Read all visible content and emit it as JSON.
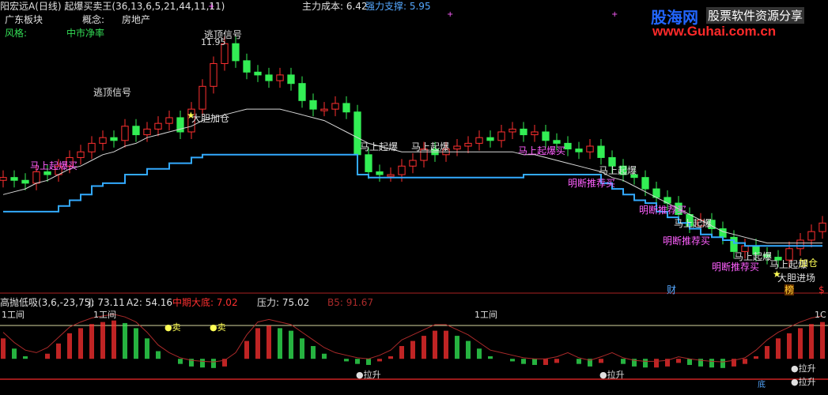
{
  "header": {
    "title": "阳宏远A(日线) 起爆买卖王(36,13,6,5,21,44,11,11)",
    "main_cost_label": "主力成本: 6.42",
    "support_label": "强力支撑: 5.95",
    "sector_label": "广东板块",
    "concept_label": "概念:",
    "concept_value": "房地产",
    "style_label": "风格:",
    "style_value": "中市净率"
  },
  "logo": {
    "brand": "股海网",
    "slogan": "股票软件资源分享",
    "url": "www.Guhai.com.cn"
  },
  "upper_annotations": {
    "top_price": "11.95",
    "escape_signal_1": "逃顶信号",
    "escape_signal_2": "逃顶信号",
    "add_position": "大胆加仓",
    "surge_buy": "马上起爆买",
    "surge_1": "马上起爆",
    "surge_2": "马上起爆",
    "surge_buy_2": "马上起爆买",
    "surge_3": "马上起爆",
    "surge_4": "马上起爆",
    "surge_5": "马上起爆",
    "surge_6": "马上起爆",
    "recommend_buy_1": "明断推荐买",
    "recommend_buy_2": "明断推荐买",
    "recommend_buy_3": "明断推荐买",
    "recommend_buy_4": "明断推荐买",
    "add_position_2": "加仓",
    "brave_entry": "大胆进场",
    "cai_mark": "财",
    "bang_mark": "榜",
    "dollar_mark": "$"
  },
  "lower_header": {
    "indicator_name": "高抛低吸(3,6,-23,75)",
    "j_value": "J: 73.11",
    "a2_value": "A2: 54.16",
    "mid_bottom": "中期大底: 7.02",
    "pressure": "压力: 75.02",
    "b5": "B5: 91.67"
  },
  "lower_annotations": {
    "peak_1": "1工间",
    "peak_2": "1工间",
    "peak_3": "1工间",
    "sell_1": "●卖",
    "sell_2": "●卖",
    "pull_1": "●拉升",
    "pull_2": "●拉升",
    "pull_3": "●拉升",
    "pull_4": "●拉升",
    "low_mark": "底",
    "right_mark": "1C"
  },
  "colors": {
    "up": "#ff3030",
    "down": "#33ee55",
    "support_line": "#33aaff",
    "ma_line": "#d8d8d8",
    "magenta": "#ff55ff",
    "yellow": "#ffff55"
  },
  "chart_data": [
    {
      "type": "line",
      "title": "阳宏远A(日线) 起爆买卖王(36,13,6,5,21,44,11,11)",
      "series": [
        {
          "name": "close",
          "values": [
            7.2,
            7.1,
            7.0,
            7.4,
            7.3,
            7.6,
            7.9,
            8.1,
            8.4,
            8.6,
            8.5,
            9.0,
            8.7,
            8.9,
            9.1,
            9.3,
            8.8,
            9.6,
            10.4,
            11.2,
            11.9,
            11.3,
            10.9,
            10.8,
            10.6,
            10.8,
            10.5,
            9.9,
            9.6,
            9.6,
            9.8,
            9.5,
            8.0,
            7.4,
            7.3,
            7.3,
            7.6,
            7.8,
            8.2,
            8.0,
            8.2,
            8.3,
            8.4,
            8.6,
            8.5,
            8.8,
            8.9,
            8.7,
            8.8,
            8.5,
            8.4,
            8.2,
            8.1,
            8.3,
            7.9,
            7.6,
            7.3,
            7.2,
            6.8,
            6.5,
            6.3,
            5.9,
            5.5,
            5.7,
            5.4,
            5.1,
            4.6,
            4.8,
            4.5,
            4.4,
            4.3,
            4.7,
            5.0,
            5.3,
            5.6
          ]
        },
        {
          "name": "support",
          "values": [
            6.0,
            6.0,
            6.0,
            6.0,
            6.0,
            6.2,
            6.4,
            6.6,
            6.9,
            7.0,
            7.0,
            7.3,
            7.3,
            7.5,
            7.5,
            7.7,
            7.7,
            7.9,
            8.0,
            8.0,
            8.0,
            8.0,
            8.0,
            8.0,
            8.0,
            8.0,
            8.0,
            8.0,
            8.0,
            8.0,
            8.0,
            8.0,
            7.3,
            7.2,
            7.2,
            7.2,
            7.2,
            7.2,
            7.2,
            7.2,
            7.2,
            7.2,
            7.2,
            7.2,
            7.2,
            7.2,
            7.2,
            7.3,
            7.3,
            7.3,
            7.3,
            7.3,
            7.3,
            7.3,
            7.0,
            6.8,
            6.6,
            6.4,
            6.3,
            6.0,
            5.8,
            5.6,
            5.4,
            5.2,
            5.1,
            5.0,
            4.9,
            4.8,
            4.8,
            4.8,
            4.8,
            4.8,
            4.8,
            4.8,
            4.8
          ]
        },
        {
          "name": "ma",
          "values": [
            6.6,
            6.7,
            6.8,
            7.0,
            7.1,
            7.3,
            7.5,
            7.6,
            7.8,
            8.0,
            8.1,
            8.3,
            8.4,
            8.6,
            8.7,
            8.8,
            8.9,
            9.0,
            9.2,
            9.3,
            9.4,
            9.5,
            9.6,
            9.6,
            9.6,
            9.6,
            9.5,
            9.4,
            9.3,
            9.2,
            9.0,
            8.8,
            8.6,
            8.4,
            8.3,
            8.2,
            8.1,
            8.1,
            8.1,
            8.1,
            8.1,
            8.1,
            8.1,
            8.1,
            8.1,
            8.1,
            8.1,
            8.0,
            8.0,
            7.9,
            7.8,
            7.7,
            7.6,
            7.5,
            7.4,
            7.2,
            7.1,
            6.9,
            6.7,
            6.5,
            6.3,
            6.1,
            5.9,
            5.7,
            5.5,
            5.3,
            5.2,
            5.1,
            5.0,
            4.9,
            4.9,
            4.9,
            4.9,
            4.9,
            4.9
          ]
        }
      ],
      "xlabel": "",
      "ylabel": "",
      "ylim": [
        4.0,
        12.6
      ]
    },
    {
      "type": "bar",
      "title": "高抛低吸(3,6,-23,75)",
      "series": [
        {
          "name": "J",
          "values": [
            60,
            40,
            25,
            20,
            30,
            50,
            70,
            80,
            88,
            92,
            95,
            90,
            80,
            60,
            35,
            20,
            10,
            5,
            3,
            2,
            5,
            20,
            55,
            80,
            85,
            80,
            75,
            60,
            45,
            30,
            20,
            15,
            10,
            8,
            15,
            25,
            45,
            55,
            65,
            75,
            75,
            65,
            55,
            40,
            25,
            20,
            15,
            10,
            8,
            8,
            12,
            20,
            10,
            5,
            12,
            20,
            10,
            5,
            3,
            3,
            5,
            12,
            8,
            5,
            3,
            2,
            5,
            10,
            25,
            45,
            60,
            70,
            80,
            88,
            92
          ]
        }
      ],
      "xlabel": "",
      "ylabel": "",
      "ylim": [
        -23,
        110
      ]
    }
  ]
}
